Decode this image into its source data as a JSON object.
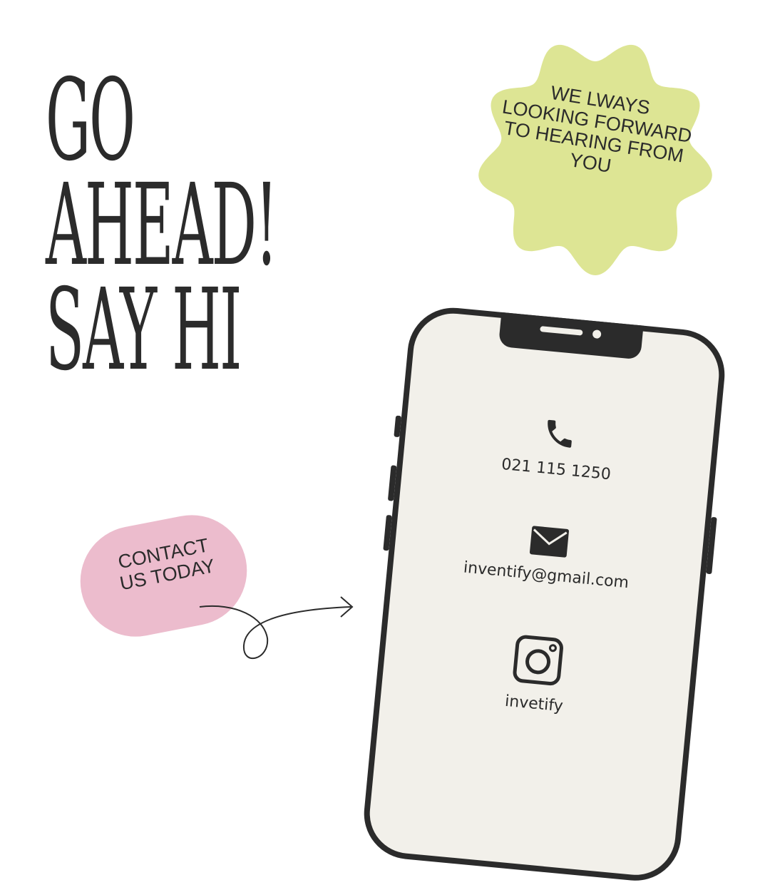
{
  "headline": {
    "line1": "GO",
    "line2": "AHEAD!",
    "line3": "SAY HI"
  },
  "badge": {
    "text": "WE LWAYS LOOKING FORWARD TO HEARING FROM YOU",
    "color": "#dde594"
  },
  "cta": {
    "line1": "CONTACT",
    "line2": "US TODAY",
    "color": "#ecbccd"
  },
  "phone": {
    "screen_color": "#f2f0ea",
    "frame_color": "#2b2b2b",
    "contacts": [
      {
        "icon": "phone-icon",
        "text": "021 115 1250"
      },
      {
        "icon": "mail-icon",
        "text": "inventify@gmail.com"
      },
      {
        "icon": "instagram-icon",
        "text": "invetify"
      }
    ]
  }
}
